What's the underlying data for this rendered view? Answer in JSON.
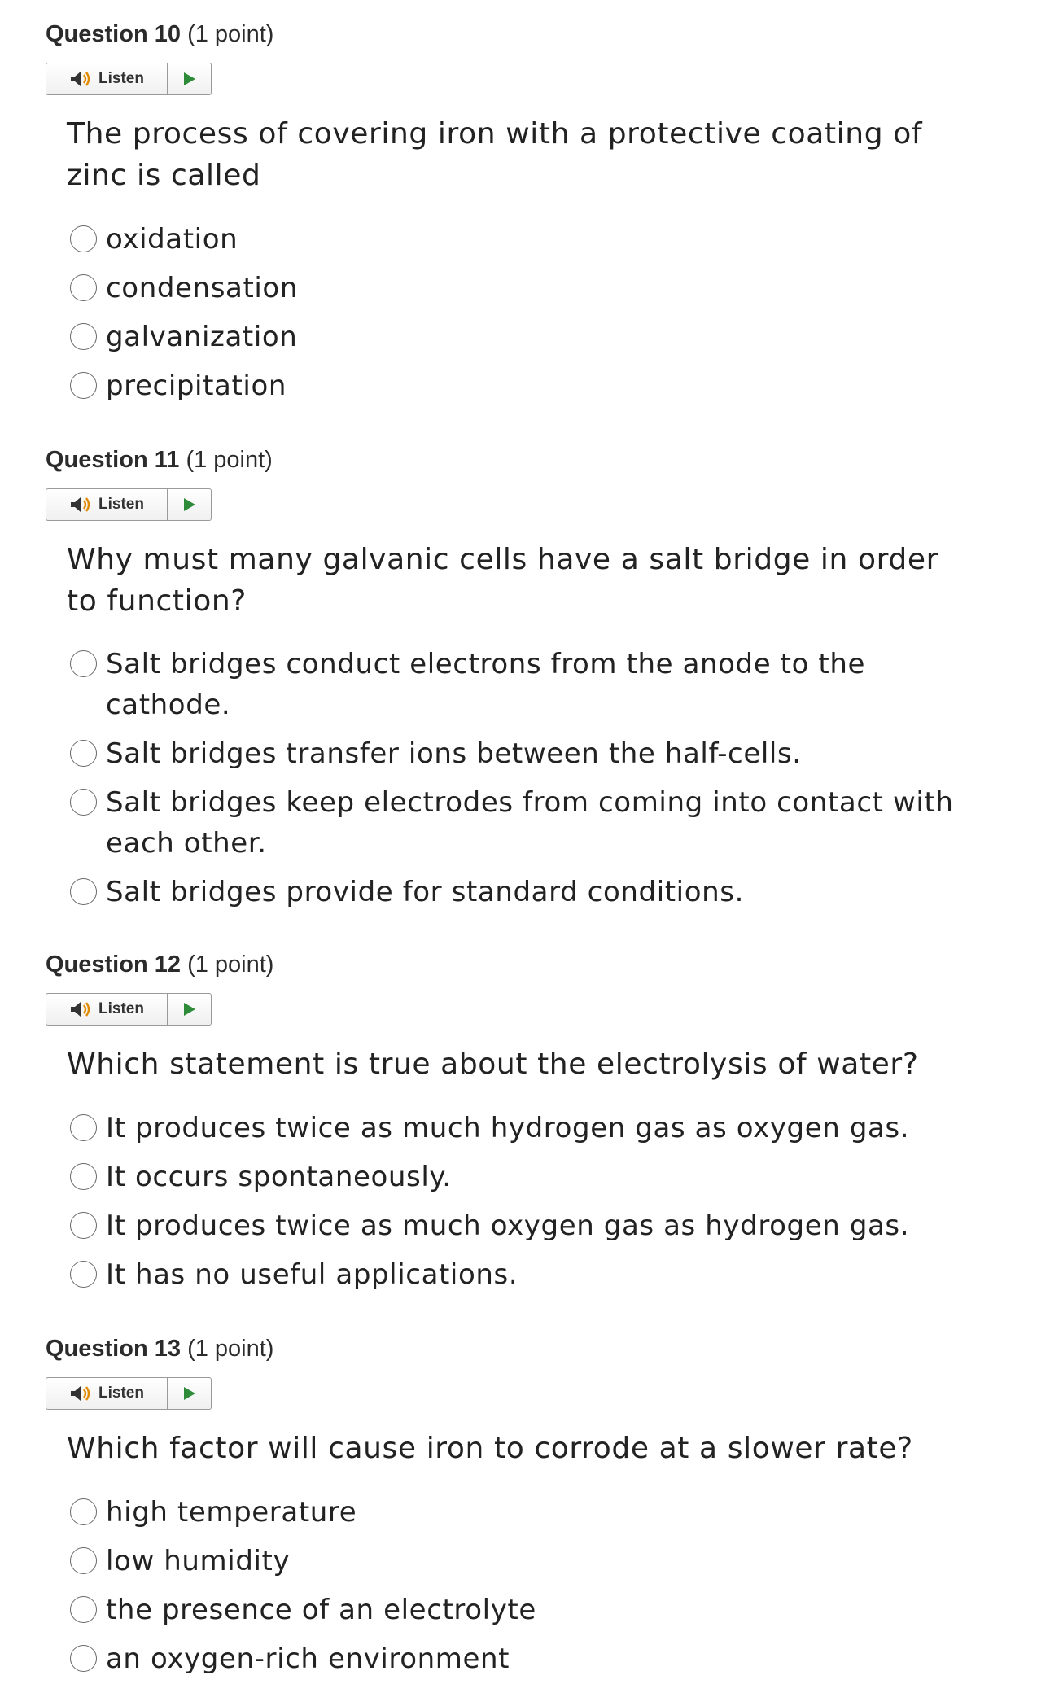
{
  "questions": [
    {
      "number_label": "Question 10",
      "points_label": "(1 point)",
      "listen_label": "Listen",
      "text": "The process of covering iron with a protective coating of zinc is called",
      "options": [
        "oxidation",
        "condensation",
        "galvanization",
        "precipitation"
      ]
    },
    {
      "number_label": "Question 11",
      "points_label": "(1 point)",
      "listen_label": "Listen",
      "text": "Why must many galvanic cells have a salt bridge in order to function?",
      "options": [
        "Salt bridges conduct electrons from the anode to the cathode.",
        "Salt bridges transfer ions between the half-cells.",
        "Salt bridges keep electrodes from coming into contact with each other.",
        "Salt bridges provide for standard conditions."
      ]
    },
    {
      "number_label": "Question 12",
      "points_label": "(1 point)",
      "listen_label": "Listen",
      "text": "Which statement is true about the electrolysis of water?",
      "options": [
        "It produces twice as much hydrogen gas as oxygen gas.",
        "It occurs spontaneously.",
        "It produces twice as much oxygen gas as hydrogen gas.",
        "It has no useful applications."
      ]
    },
    {
      "number_label": "Question 13",
      "points_label": "(1 point)",
      "listen_label": "Listen",
      "text": "Which factor will cause iron to corrode at a slower rate?",
      "options": [
        "high temperature",
        "low humidity",
        "the presence of an electrolyte",
        "an oxygen-rich environment"
      ]
    }
  ],
  "icons": {
    "speaker": "speaker-icon",
    "play": "play-icon"
  },
  "colors": {
    "play_green": "#2e8b3a",
    "radio_border": "#6a6a6a"
  }
}
